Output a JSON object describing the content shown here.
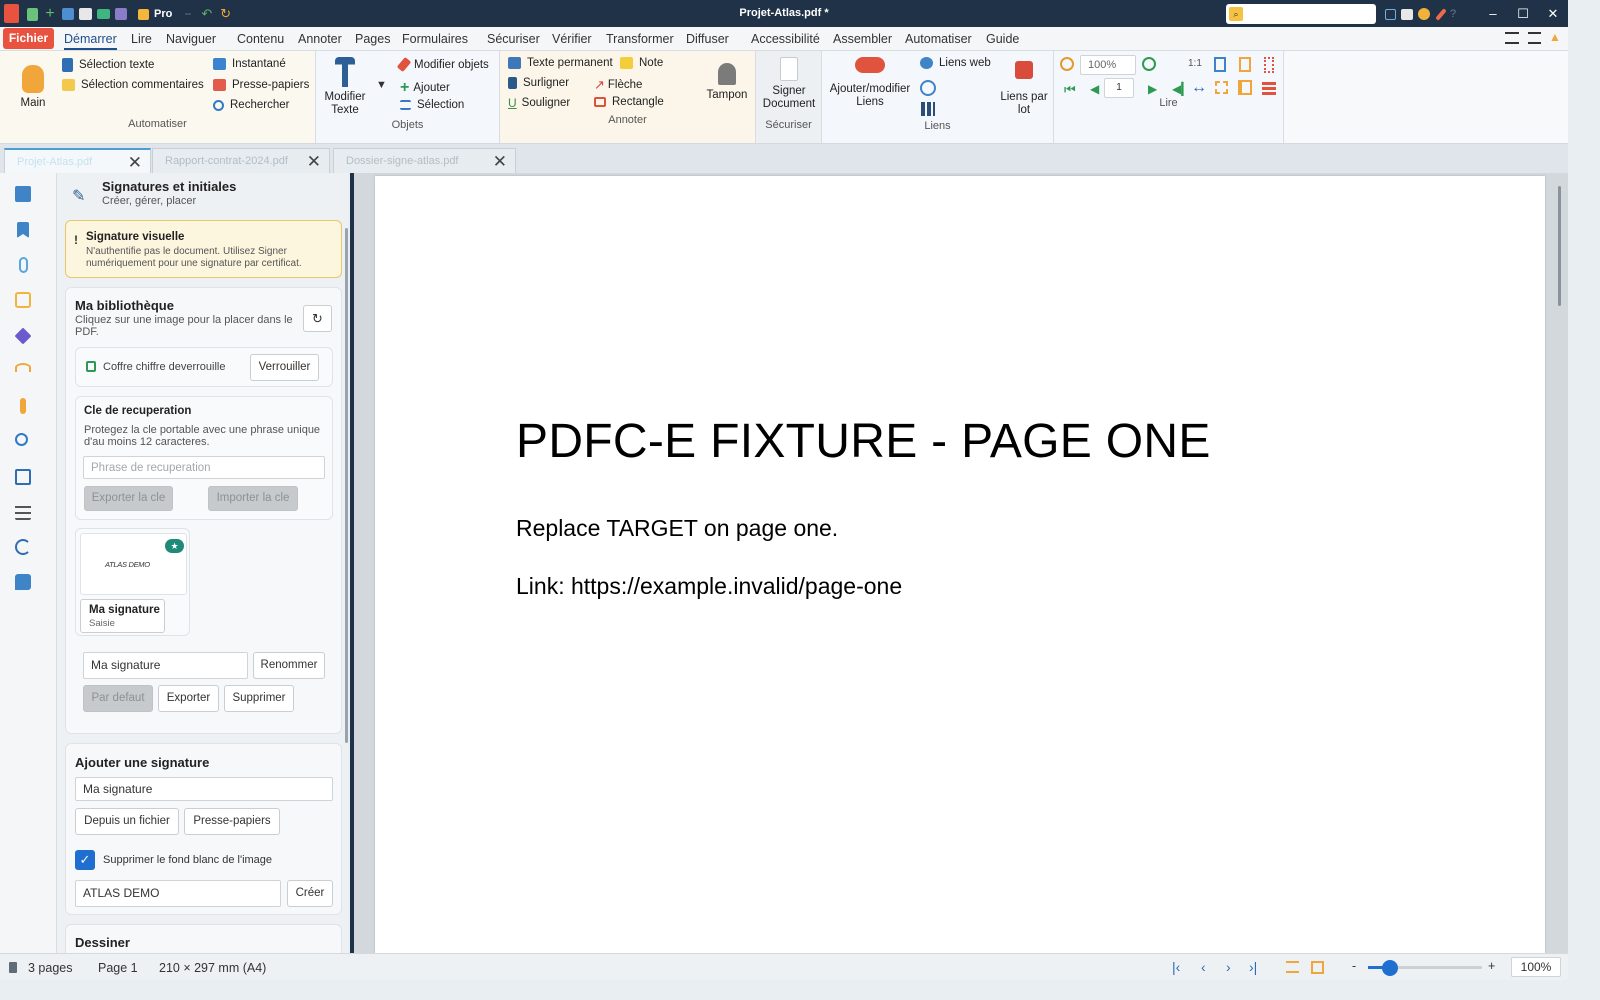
{
  "window": {
    "title": "Projet-Atlas.pdf *",
    "edition": "Pro"
  },
  "menu": {
    "fichier": "Fichier",
    "items": [
      "Démarrer",
      "Lire",
      "Naviguer",
      "Contenu",
      "Annoter",
      "Pages",
      "Formulaires",
      "Sécuriser",
      "Vérifier",
      "Transformer",
      "Diffuser",
      "Accessibilité",
      "Assembler",
      "Automatiser",
      "Guide"
    ]
  },
  "ribbon": {
    "main_label": "Main",
    "automatiser": {
      "selection_texte": "Sélection texte",
      "selection_commentaires": "Sélection commentaires",
      "instantane": "Instantané",
      "presse_papiers": "Presse-papiers",
      "rechercher": "Rechercher",
      "group": "Automatiser"
    },
    "objets": {
      "modifier_texte": "Modifier Texte",
      "modifier_objets": "Modifier objets",
      "ajouter": "Ajouter",
      "selection": "Sélection",
      "group": "Objets"
    },
    "annoter": {
      "texte_permanent": "Texte permanent",
      "note": "Note",
      "surligner": "Surligner",
      "fleche": "Flèche",
      "souligner": "Souligner",
      "rectangle": "Rectangle",
      "tampon": "Tampon",
      "group": "Annoter"
    },
    "securiser": {
      "signer_document": "Signer Document",
      "group": "Sécuriser"
    },
    "liens": {
      "ajouter_modifier": "Ajouter/modifier Liens",
      "liens_web": "Liens web",
      "liens_par_lot": "Liens par lot",
      "group": "Liens"
    },
    "lire": {
      "zoom": "100%",
      "page": "1",
      "ratio": "1:1",
      "group": "Lire"
    }
  },
  "tabs": [
    {
      "label": "Projet-Atlas.pdf"
    },
    {
      "label": "Rapport-contrat-2024.pdf"
    },
    {
      "label": "Dossier-signe-atlas.pdf"
    }
  ],
  "panel": {
    "title": "Signatures et initiales",
    "subtitle": "Créer, gérer, placer",
    "warning_title": "Signature visuelle",
    "warning_text": "N'authentifie pas le document. Utilisez Signer numériquement pour une signature par certificat.",
    "library_title": "Ma bibliothèque",
    "library_hint": "Cliquez sur une image pour la placer dans le PDF.",
    "vault_text": "Coffre chiffre deverrouille",
    "lock_button": "Verrouiller",
    "recovery_title": "Cle de recuperation",
    "recovery_text": "Protegez la cle portable avec une phrase unique d'au moins 12 caracteres.",
    "recovery_placeholder": "Phrase de recuperation",
    "export_key": "Exporter la cle",
    "import_key": "Importer la cle",
    "signature_image_text": "ATLAS DEMO",
    "signature_name": "Ma signature",
    "signature_type": "Saisie",
    "rename_value": "Ma signature",
    "rename_button": "Renommer",
    "default_button": "Par defaut",
    "export_button": "Exporter",
    "delete_button": "Supprimer",
    "add_title": "Ajouter une signature",
    "add_name_value": "Ma signature",
    "from_file": "Depuis un fichier",
    "from_clipboard": "Presse-papiers",
    "remove_bg_label": "Supprimer le fond blanc de l'image",
    "remove_bg_checked": true,
    "text_value": "ATLAS DEMO",
    "create_button": "Créer",
    "draw_title": "Dessiner"
  },
  "document": {
    "title": "PDFC-E FIXTURE - PAGE ONE",
    "line1": "Replace TARGET on page one.",
    "line2": "Link: https://example.invalid/page-one"
  },
  "status": {
    "pages": "3 pages",
    "current_page": "Page 1",
    "size": "210 × 297 mm (A4)",
    "zoom": "100%"
  },
  "colors": {
    "titlebar": "#1f3247",
    "accent_red": "#e8523f",
    "accent_blue": "#1f4f8a",
    "warning_bg": "#fdf6df",
    "warning_border": "#e7c76a"
  }
}
